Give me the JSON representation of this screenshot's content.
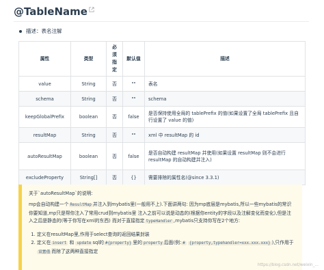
{
  "heading": {
    "title": "@TableName",
    "link_icon": "external-link-icon"
  },
  "description": "描述：表名注解",
  "table": {
    "headers": [
      "属性",
      "类型",
      "必须指定",
      "默认值",
      "描述"
    ],
    "rows": [
      [
        "value",
        "String",
        "否",
        "\"\"",
        "表名"
      ],
      [
        "schema",
        "String",
        "否",
        "\"\"",
        "schema"
      ],
      [
        "keepGlobalPrefix",
        "boolean",
        "否",
        "false",
        "是否保持使用全局的 tablePrefix 的值(如果设置了全局 tablePrefix 且自行设置了 value 的值)"
      ],
      [
        "resultMap",
        "String",
        "否",
        "\"\"",
        "xml 中 resultMap 的 id"
      ],
      [
        "autoResultMap",
        "boolean",
        "否",
        "false",
        "是否自动构建 resultMap 并使用(如果设置 resultMap 则不会进行 resultMap 的自动构建并注入)"
      ],
      [
        "excludeProperty",
        "String[]",
        "否",
        "{}",
        "需要排除的属性名(@since 3.3.1)"
      ]
    ]
  },
  "tip": {
    "title": "关于`autoResultMap`的说明:",
    "para_a": "mp会自动构建一个",
    "code_resultmap": "ResultMap",
    "para_b": "并注入到mybatis里(一般用不上).下面讲两句: 因为mp底层是mybatis,所以一些mybatis的常识你要知道,mp只是帮你注入了常用crud到mybatis里 注入之前可以说是动态的(根据你entity的字段以及注解变化而变化),但是注入之后是静态的(等于你写在xml的东西) 而对于直接指定",
    "code_typehandler": "typeHandler",
    "para_c": ",mybatis只支持你写在2个地方:",
    "item1": "定义在resultMap里,作用于select查询的返回结果封装",
    "item2_a": "定义在",
    "code_insert": "insert",
    "item2_b": "和",
    "code_update": "update",
    "item2_c": "sql的",
    "code_prop": "#{property}",
    "item2_d": "里的",
    "code_property": "property",
    "item2_e": "后面(例:",
    "code_hash": "#",
    "item2_f": "{property,typehandler=xxx.xxx.xxx}",
    "item2_g": "),只作用于",
    "code_setval": "设置值",
    "item2_h": "而除了这两种直接指定"
  },
  "watermark": "https://blog.csdn.net/weixin_..."
}
